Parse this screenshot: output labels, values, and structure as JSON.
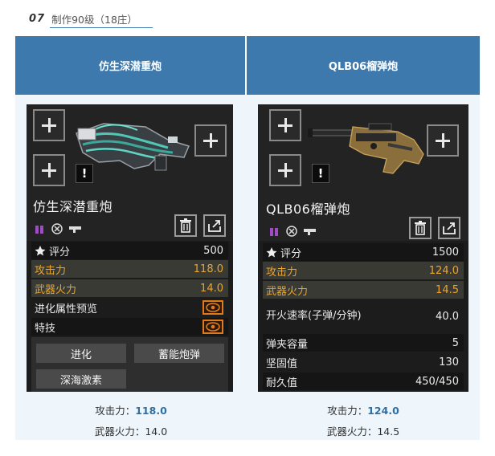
{
  "section": {
    "number": "07",
    "title": "制作90级（18庄）"
  },
  "table": {
    "headers": [
      "仿生深潜重炮",
      "QLB06榴弹炮"
    ]
  },
  "left_card": {
    "name": "仿生深潜重炮",
    "warning_mark": "!",
    "stats": [
      {
        "label": "评分",
        "value": "500"
      },
      {
        "label": "攻击力",
        "value": "118.0"
      },
      {
        "label": "武器火力",
        "value": "14.0"
      },
      {
        "label": "进化属性预览",
        "value": ""
      },
      {
        "label": "特技",
        "value": ""
      }
    ],
    "buttons": [
      "进化",
      "蓄能炮弹",
      "深海激素"
    ]
  },
  "right_card": {
    "name": "QLB06榴弹炮",
    "warning_mark": "!",
    "stats": [
      {
        "label": "评分",
        "value": "1500"
      },
      {
        "label": "攻击力",
        "value": "124.0"
      },
      {
        "label": "武器火力",
        "value": "14.5"
      },
      {
        "label": "开火速率(子弹/分钟)",
        "value": "40.0"
      },
      {
        "label": "弹夹容量",
        "value": "5"
      },
      {
        "label": "坚固值",
        "value": "130"
      },
      {
        "label": "耐久值",
        "value": "450/450"
      }
    ]
  },
  "captions": {
    "left": {
      "attack_label": "攻击力：",
      "attack_value": "118.0",
      "fire_label": "武器火力：",
      "fire_value": "14.0"
    },
    "right": {
      "attack_label": "攻击力：",
      "attack_value": "124.0",
      "fire_label": "武器火力：",
      "fire_value": "14.5"
    }
  },
  "colors": {
    "header_blue": "#3e79ad",
    "highlight_orange": "#e9a52f",
    "caption_blue": "#2e6ea3"
  }
}
